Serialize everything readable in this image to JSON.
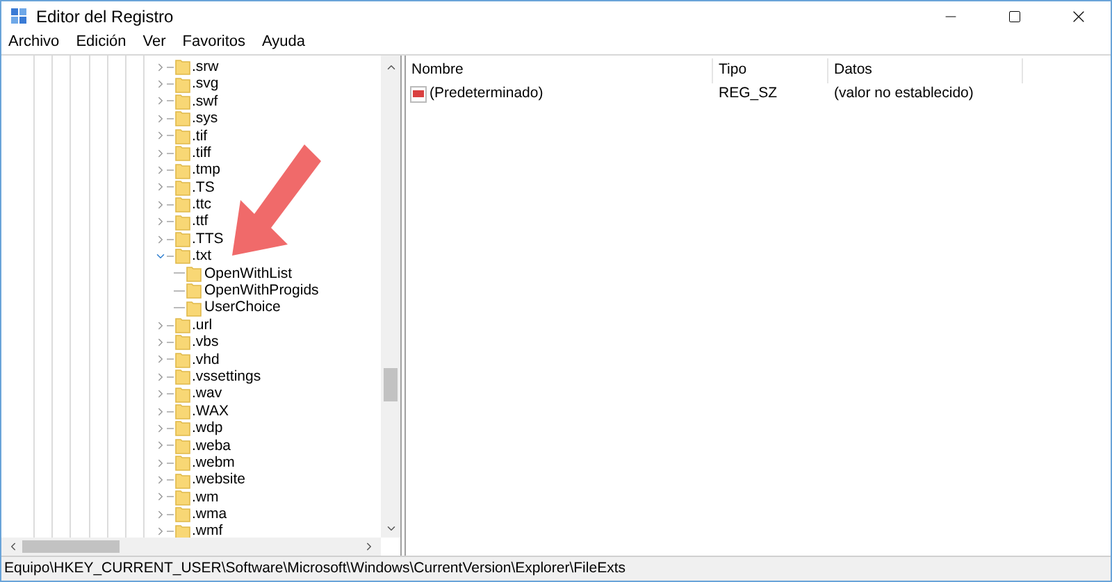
{
  "window": {
    "title": "Editor del Registro"
  },
  "menu": [
    "Archivo",
    "Edición",
    "Ver",
    "Favoritos",
    "Ayuda"
  ],
  "tree": [
    {
      "label": ".srw",
      "expanded": false
    },
    {
      "label": ".svg",
      "expanded": false
    },
    {
      "label": ".swf",
      "expanded": false
    },
    {
      "label": ".sys",
      "expanded": false
    },
    {
      "label": ".tif",
      "expanded": false
    },
    {
      "label": ".tiff",
      "expanded": false
    },
    {
      "label": ".tmp",
      "expanded": false
    },
    {
      "label": ".TS",
      "expanded": false
    },
    {
      "label": ".ttc",
      "expanded": false
    },
    {
      "label": ".ttf",
      "expanded": false
    },
    {
      "label": ".TTS",
      "expanded": false
    },
    {
      "label": ".txt",
      "expanded": true,
      "children": [
        {
          "label": "OpenWithList"
        },
        {
          "label": "OpenWithProgids"
        },
        {
          "label": "UserChoice"
        }
      ]
    },
    {
      "label": ".url",
      "expanded": false
    },
    {
      "label": ".vbs",
      "expanded": false
    },
    {
      "label": ".vhd",
      "expanded": false
    },
    {
      "label": ".vssettings",
      "expanded": false
    },
    {
      "label": ".wav",
      "expanded": false
    },
    {
      "label": ".WAX",
      "expanded": false
    },
    {
      "label": ".wdp",
      "expanded": false
    },
    {
      "label": ".weba",
      "expanded": false
    },
    {
      "label": ".webm",
      "expanded": false
    },
    {
      "label": ".website",
      "expanded": false
    },
    {
      "label": ".wm",
      "expanded": false
    },
    {
      "label": ".wma",
      "expanded": false
    },
    {
      "label": ".wmf",
      "expanded": false
    }
  ],
  "values": {
    "columns": [
      "Nombre",
      "Tipo",
      "Datos"
    ],
    "rows": [
      {
        "name": "(Predeterminado)",
        "type": "REG_SZ",
        "data": "(valor no establecido)"
      }
    ]
  },
  "status_bar": "Equipo\\HKEY_CURRENT_USER\\Software\\Microsoft\\Windows\\CurrentVersion\\Explorer\\FileExts"
}
